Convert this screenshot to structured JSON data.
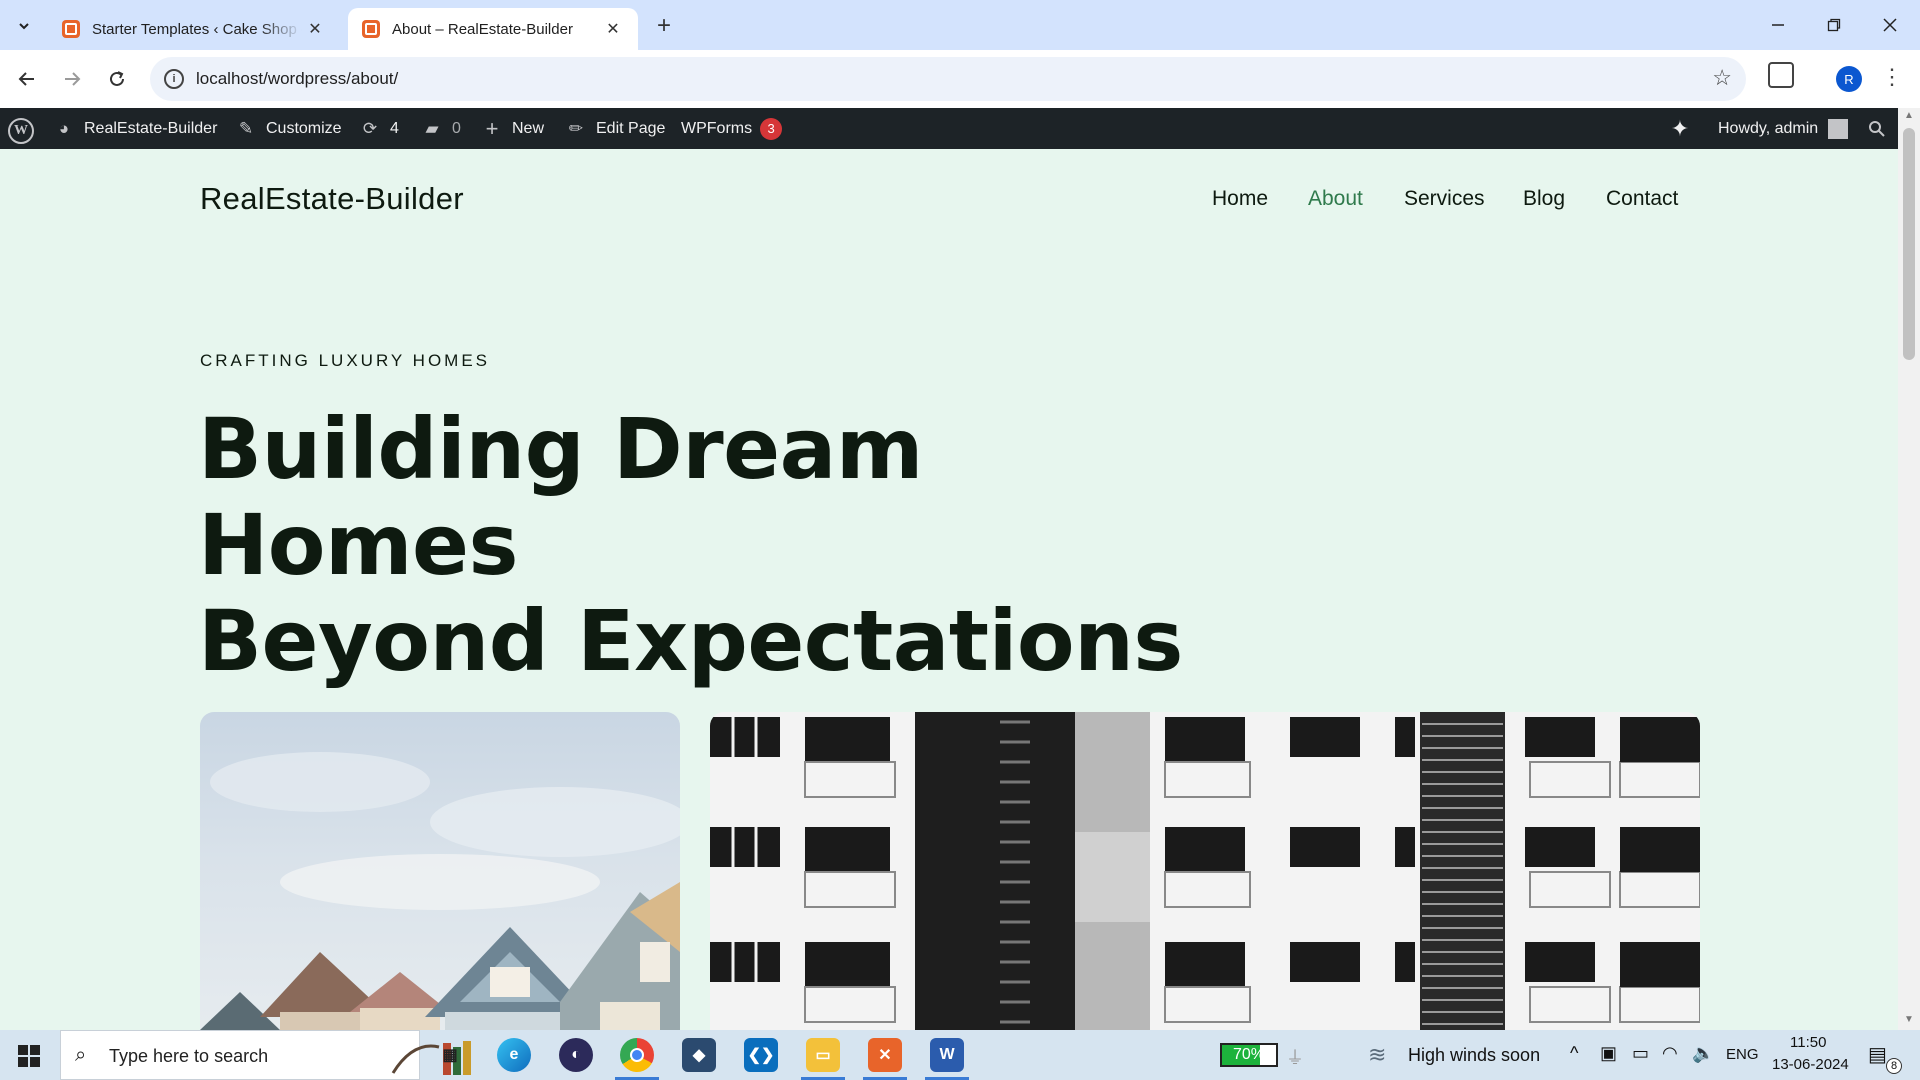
{
  "browser": {
    "tabs": [
      {
        "title": "Starter Templates ‹ Cake Shop –"
      },
      {
        "title": "About – RealEstate-Builder"
      }
    ],
    "url": "localhost/wordpress/about/",
    "profile_initial": "R"
  },
  "adminbar": {
    "site": "RealEstate-Builder",
    "customize": "Customize",
    "updates_count": "4",
    "comments_count": "0",
    "new": "New",
    "edit_page": "Edit Page",
    "wpforms": "WPForms",
    "wpforms_badge": "3",
    "howdy": "Howdy, admin"
  },
  "site": {
    "title": "RealEstate-Builder",
    "menu": [
      "Home",
      "About",
      "Services",
      "Blog",
      "Contact"
    ],
    "active_menu": "About",
    "eyebrow": "CRAFTING LUXURY HOMES",
    "headline_line1": "Building Dream Homes",
    "headline_line2": "Beyond Expectations"
  },
  "taskbar": {
    "search_placeholder": "Type here to search",
    "battery_percent": "70%",
    "weather": "High winds soon",
    "language": "ENG",
    "time": "11:50",
    "date": "13-06-2024",
    "notification_count": "8"
  },
  "colors": {
    "page_bg": "#e7f6ee",
    "active_link": "#2f7a4c",
    "adminbar_bg": "#1d2327",
    "tab_strip": "#d3e3fd"
  }
}
